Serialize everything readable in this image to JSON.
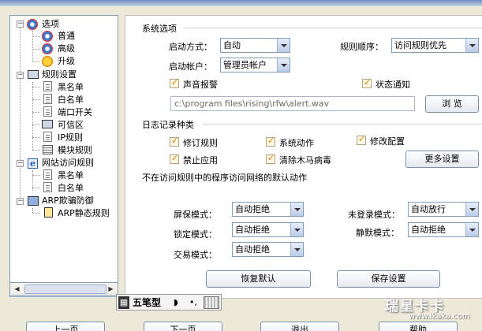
{
  "tree": {
    "root": "选项",
    "opt_children": [
      "普通",
      "高级",
      "升级"
    ],
    "rules": "规则设置",
    "rule_children": [
      "黑名单",
      "白名单",
      "端口开关",
      "可信区",
      "IP规则",
      "模块规则"
    ],
    "web": "网站访问规则",
    "web_children": [
      "黑名单",
      "白名单"
    ],
    "arp": "ARP欺骗防御",
    "arp_children": [
      "ARP静态规则"
    ]
  },
  "system": {
    "title": "系统选项",
    "start_mode_label": "启动方式：",
    "start_mode_value": "自动",
    "rule_order_label": "规则顺序：",
    "rule_order_value": "访问规则优先",
    "start_account_label": "启动帐户：",
    "start_account_value": "管理员帐户",
    "sound_alarm": "声音报警",
    "status_notify": "状态通知",
    "log_path": "c:\\program files\\rising\\rfw\\alert.wav",
    "browse": "浏 览"
  },
  "log": {
    "title": "日志记录种类",
    "items": [
      "修订规则",
      "系统动作",
      "修改配置",
      "禁止应用",
      "清除木马病毒"
    ],
    "more": "更多设置"
  },
  "default_action": {
    "title": "不在访问规则中的程序访问网络的默认动作",
    "screensaver_label": "屏保模式：",
    "screensaver_value": "自动拒绝",
    "notlogged_label": "未登录模式：",
    "notlogged_value": "自动放行",
    "lock_label": "锁定模式：",
    "lock_value": "自动拒绝",
    "silent_label": "静默模式：",
    "silent_value": "自动拒绝",
    "trade_label": "交易模式：",
    "trade_value": "自动拒绝",
    "restore": "恢复默认",
    "save": "保存设置"
  },
  "ime": {
    "name": "五笔型"
  },
  "bottom": {
    "prev": "上一页",
    "next": "下一页",
    "exit": "退出",
    "help": "帮助"
  },
  "watermark": {
    "brand": "瑞星卡卡",
    "url": "www.ikaka.com"
  }
}
